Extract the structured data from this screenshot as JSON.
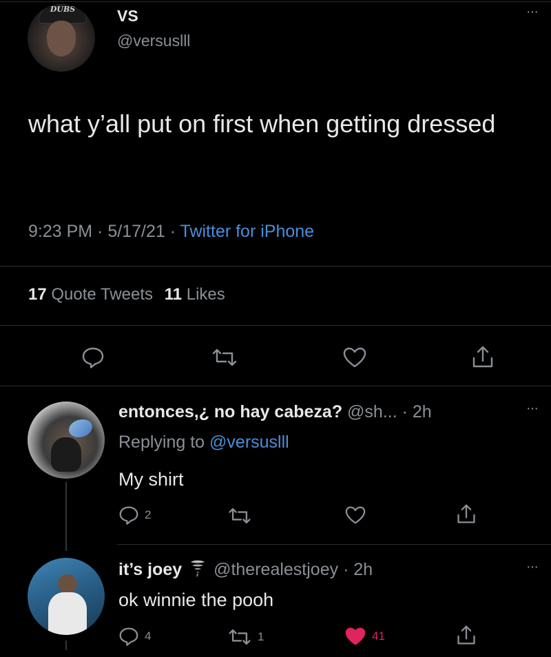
{
  "main_tweet": {
    "display_name": "VS",
    "handle": "@versuslll",
    "text": "what y’all put on first when getting dressed",
    "time": "9:23 PM",
    "date": "5/17/21",
    "source": "Twitter for iPhone",
    "quote_count": "17",
    "quote_label": "Quote Tweets",
    "like_count": "11",
    "like_label": "Likes",
    "avatar_cap_text": "DUBS"
  },
  "replies": [
    {
      "display_name": "entonces,¿ no hay cabeza?",
      "handle": "@sh...",
      "time": "2h",
      "replying_label": "Replying to",
      "replying_handle": "@versuslll",
      "text": "My shirt",
      "reply_count": "2",
      "retweet_count": "",
      "like_count": ""
    },
    {
      "display_name": "it’s joey",
      "handle": "@therealestjoey",
      "time": "2h",
      "text": "ok winnie the pooh",
      "reply_count": "4",
      "retweet_count": "1",
      "like_count": "41",
      "liked": true
    }
  ],
  "separator": "·",
  "more_glyph": "···",
  "colors": {
    "background": "#000000",
    "text": "#d9d9d9",
    "muted": "#8b9096",
    "link": "#4a8fd8",
    "like_active": "#e0245e"
  },
  "icons": [
    "reply-icon",
    "retweet-icon",
    "like-icon",
    "share-icon",
    "more-icon",
    "tornado-emoji-icon"
  ]
}
